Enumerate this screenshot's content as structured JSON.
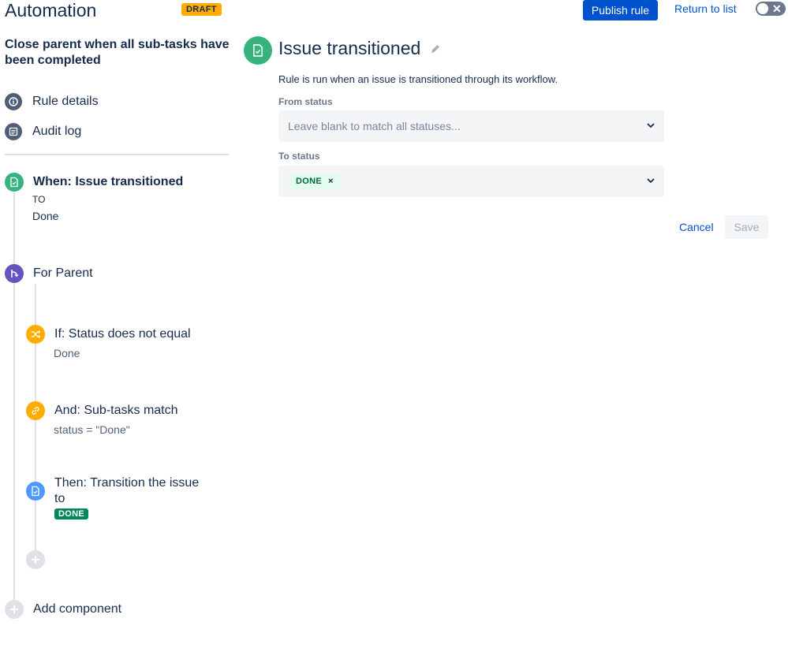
{
  "header": {
    "title": "Automation",
    "draft_badge": "DRAFT",
    "publish_label": "Publish rule",
    "return_label": "Return to list",
    "toggle_mark": "✕"
  },
  "sidebar": {
    "rule_name": "Close parent when all sub-tasks have been completed",
    "nav": [
      {
        "label": "Rule details",
        "icon": "info-icon"
      },
      {
        "label": "Audit log",
        "icon": "list-icon"
      }
    ]
  },
  "steps": {
    "trigger": {
      "title": "When: Issue transitioned",
      "sub1": "TO",
      "sub2": "Done",
      "color": "#36B37E"
    },
    "branch": {
      "title": "For Parent",
      "color": "#6554C0"
    },
    "condition1": {
      "title": "If: Status does not equal",
      "sub": "Done",
      "color": "#FFAB00"
    },
    "condition2": {
      "title": "And: Sub-tasks match",
      "sub": "status = \"Done\"",
      "color": "#FFAB00"
    },
    "action": {
      "title_line1": "Then: Transition the issue",
      "title_line2": "to",
      "lozenge": "DONE",
      "color": "#4C9AFF"
    },
    "add_component": "Add component"
  },
  "panel": {
    "title": "Issue transitioned",
    "description": "Rule is run when an issue is transitioned through its workflow.",
    "from_status": {
      "label": "From status",
      "placeholder": "Leave blank to match all statuses..."
    },
    "to_status": {
      "label": "To status",
      "value": "DONE",
      "remove": "×"
    },
    "cancel_label": "Cancel",
    "save_label": "Save"
  }
}
